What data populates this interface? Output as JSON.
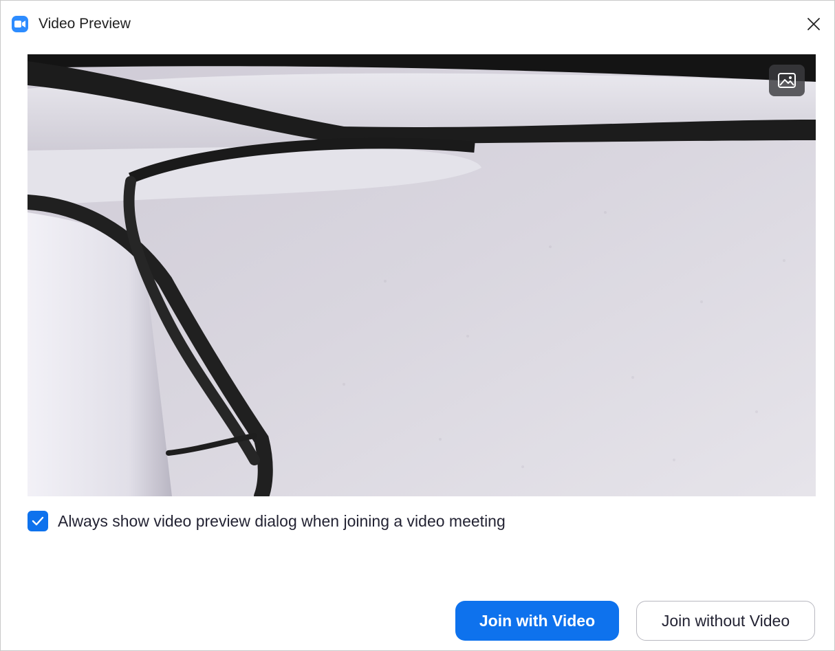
{
  "window": {
    "title": "Video Preview"
  },
  "preview": {
    "background_toggle_icon": "image-icon"
  },
  "options": {
    "always_show_label": "Always show video preview dialog when joining a video meeting",
    "always_show_checked": true
  },
  "actions": {
    "join_with_video": "Join with Video",
    "join_without_video": "Join without Video"
  },
  "colors": {
    "accent": "#0e72ed",
    "app_icon": "#2d8cff"
  }
}
